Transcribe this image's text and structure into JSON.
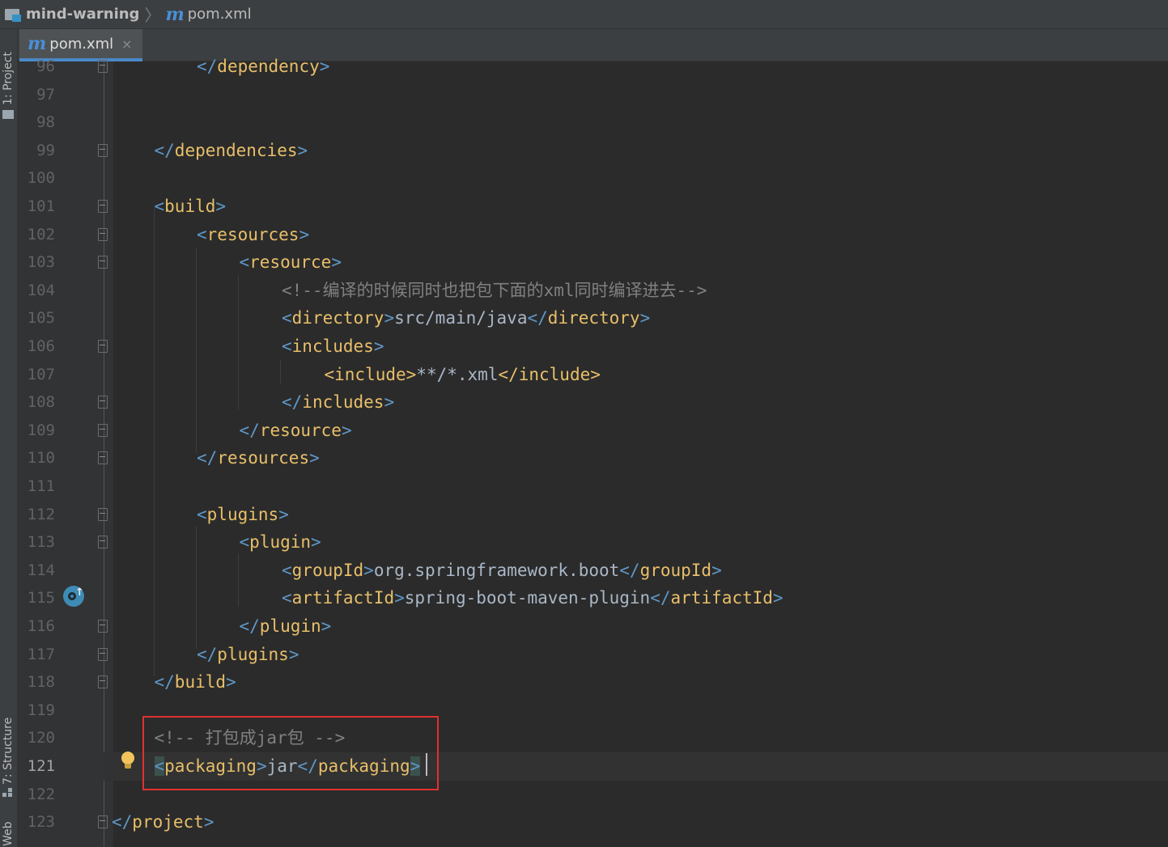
{
  "breadcrumb": {
    "project": "mind-warning",
    "file": "pom.xml"
  },
  "tab": {
    "label": "pom.xml",
    "close": "×"
  },
  "toolstrip": {
    "project_tab": "1: Project",
    "structure_tab": "7: Structure",
    "web_tab": "Web"
  },
  "lines": [
    {
      "n": "96",
      "indent": 2,
      "parts": [
        [
          "br",
          "</"
        ],
        [
          "tg",
          "dependency"
        ],
        [
          "br",
          ">"
        ]
      ]
    },
    {
      "n": "97",
      "indent": 0,
      "parts": []
    },
    {
      "n": "98",
      "indent": 0,
      "parts": []
    },
    {
      "n": "99",
      "indent": 1,
      "parts": [
        [
          "br",
          "</"
        ],
        [
          "tg",
          "dependencies"
        ],
        [
          "br",
          ">"
        ]
      ]
    },
    {
      "n": "100",
      "indent": 0,
      "parts": []
    },
    {
      "n": "101",
      "indent": 1,
      "parts": [
        [
          "br",
          "<"
        ],
        [
          "tg",
          "build"
        ],
        [
          "br",
          ">"
        ]
      ]
    },
    {
      "n": "102",
      "indent": 2,
      "parts": [
        [
          "br",
          "<"
        ],
        [
          "tg",
          "resources"
        ],
        [
          "br",
          ">"
        ]
      ]
    },
    {
      "n": "103",
      "indent": 3,
      "parts": [
        [
          "br",
          "<"
        ],
        [
          "tg",
          "resource"
        ],
        [
          "br",
          ">"
        ]
      ]
    },
    {
      "n": "104",
      "indent": 4,
      "parts": [
        [
          "cm",
          "<!--编译的时候同时也把包下面的xml同时编译进去-->"
        ]
      ]
    },
    {
      "n": "105",
      "indent": 4,
      "parts": [
        [
          "br",
          "<"
        ],
        [
          "tg",
          "directory"
        ],
        [
          "br",
          ">"
        ],
        [
          "tx",
          "src/main/java"
        ],
        [
          "br",
          "</"
        ],
        [
          "tg",
          "directory"
        ],
        [
          "br",
          ">"
        ]
      ]
    },
    {
      "n": "106",
      "indent": 4,
      "parts": [
        [
          "br",
          "<"
        ],
        [
          "tg",
          "includes"
        ],
        [
          "br",
          ">"
        ]
      ]
    },
    {
      "n": "107",
      "indent": 5,
      "parts": [
        [
          "tg",
          "<include>"
        ],
        [
          "tx",
          "**/*.xml"
        ],
        [
          "tg",
          "</include>"
        ]
      ]
    },
    {
      "n": "108",
      "indent": 4,
      "parts": [
        [
          "br",
          "</"
        ],
        [
          "tg",
          "includes"
        ],
        [
          "br",
          ">"
        ]
      ]
    },
    {
      "n": "109",
      "indent": 3,
      "parts": [
        [
          "br",
          "</"
        ],
        [
          "tg",
          "resource"
        ],
        [
          "br",
          ">"
        ]
      ]
    },
    {
      "n": "110",
      "indent": 2,
      "parts": [
        [
          "br",
          "</"
        ],
        [
          "tg",
          "resources"
        ],
        [
          "br",
          ">"
        ]
      ]
    },
    {
      "n": "111",
      "indent": 0,
      "parts": []
    },
    {
      "n": "112",
      "indent": 2,
      "parts": [
        [
          "br",
          "<"
        ],
        [
          "tg",
          "plugins"
        ],
        [
          "br",
          ">"
        ]
      ]
    },
    {
      "n": "113",
      "indent": 3,
      "parts": [
        [
          "br",
          "<"
        ],
        [
          "tg",
          "plugin"
        ],
        [
          "br",
          ">"
        ]
      ]
    },
    {
      "n": "114",
      "indent": 4,
      "parts": [
        [
          "br",
          "<"
        ],
        [
          "tg",
          "groupId"
        ],
        [
          "br",
          ">"
        ],
        [
          "tx",
          "org.springframework.boot"
        ],
        [
          "br",
          "</"
        ],
        [
          "tg",
          "groupId"
        ],
        [
          "br",
          ">"
        ]
      ]
    },
    {
      "n": "115",
      "indent": 4,
      "parts": [
        [
          "br",
          "<"
        ],
        [
          "tg",
          "artifactId"
        ],
        [
          "br",
          ">"
        ],
        [
          "tx",
          "spring-boot-maven-plugin"
        ],
        [
          "br",
          "</"
        ],
        [
          "tg",
          "artifactId"
        ],
        [
          "br",
          ">"
        ]
      ]
    },
    {
      "n": "116",
      "indent": 3,
      "parts": [
        [
          "br",
          "</"
        ],
        [
          "tg",
          "plugin"
        ],
        [
          "br",
          ">"
        ]
      ]
    },
    {
      "n": "117",
      "indent": 2,
      "parts": [
        [
          "br",
          "</"
        ],
        [
          "tg",
          "plugins"
        ],
        [
          "br",
          ">"
        ]
      ]
    },
    {
      "n": "118",
      "indent": 1,
      "parts": [
        [
          "br",
          "</"
        ],
        [
          "tg",
          "build"
        ],
        [
          "br",
          ">"
        ]
      ]
    },
    {
      "n": "119",
      "indent": 0,
      "parts": []
    },
    {
      "n": "120",
      "indent": 1,
      "parts": [
        [
          "cm",
          "<!-- 打包成jar包 -->"
        ]
      ]
    },
    {
      "n": "121",
      "indent": 1,
      "parts": [
        [
          "hb",
          "<"
        ],
        [
          "tg",
          "packaging"
        ],
        [
          "br",
          ">"
        ],
        [
          "tx",
          "jar"
        ],
        [
          "br",
          "</"
        ],
        [
          "tg",
          "packaging"
        ],
        [
          "hb",
          ">"
        ]
      ]
    },
    {
      "n": "122",
      "indent": 0,
      "parts": []
    },
    {
      "n": "123",
      "indent": 0,
      "parts": [
        [
          "br",
          "</"
        ],
        [
          "tg",
          "project"
        ],
        [
          "br",
          ">"
        ]
      ]
    }
  ],
  "current_line": "121"
}
